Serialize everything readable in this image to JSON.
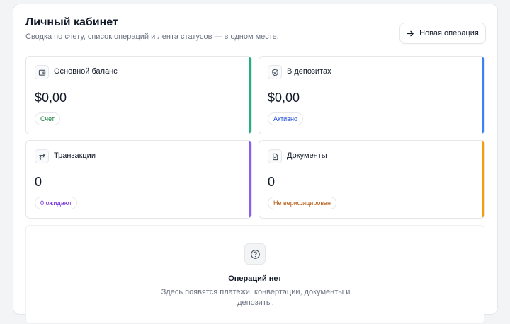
{
  "header": {
    "title": "Личный кабинет",
    "subtitle": "Сводка по счету, список операций и лента статусов — в одном месте.",
    "new_operation_label": "Новая операция"
  },
  "cards": [
    {
      "label": "Основной баланс",
      "value": "$0,00",
      "badge": "Счет",
      "icon": "wallet-icon",
      "accent": "#22b07d",
      "badge_color": "#15803d"
    },
    {
      "label": "В депозитах",
      "value": "$0,00",
      "badge": "Активно",
      "icon": "shield-icon",
      "accent": "#3b82f6",
      "badge_color": "#1d4ed8"
    },
    {
      "label": "Транзакции",
      "value": "0",
      "badge": "0 ожидают",
      "icon": "transfer-arrows-icon",
      "accent": "#8b5cf6",
      "badge_color": "#6d28d9"
    },
    {
      "label": "Документы",
      "value": "0",
      "badge": "Не верифицирован",
      "icon": "document-icon",
      "accent": "#f59e0b",
      "badge_color": "#b45309"
    }
  ],
  "empty_state": {
    "icon": "question-circle-icon",
    "title": "Операций нет",
    "description": "Здесь появятся платежи, конвертации, документы и депозиты."
  }
}
